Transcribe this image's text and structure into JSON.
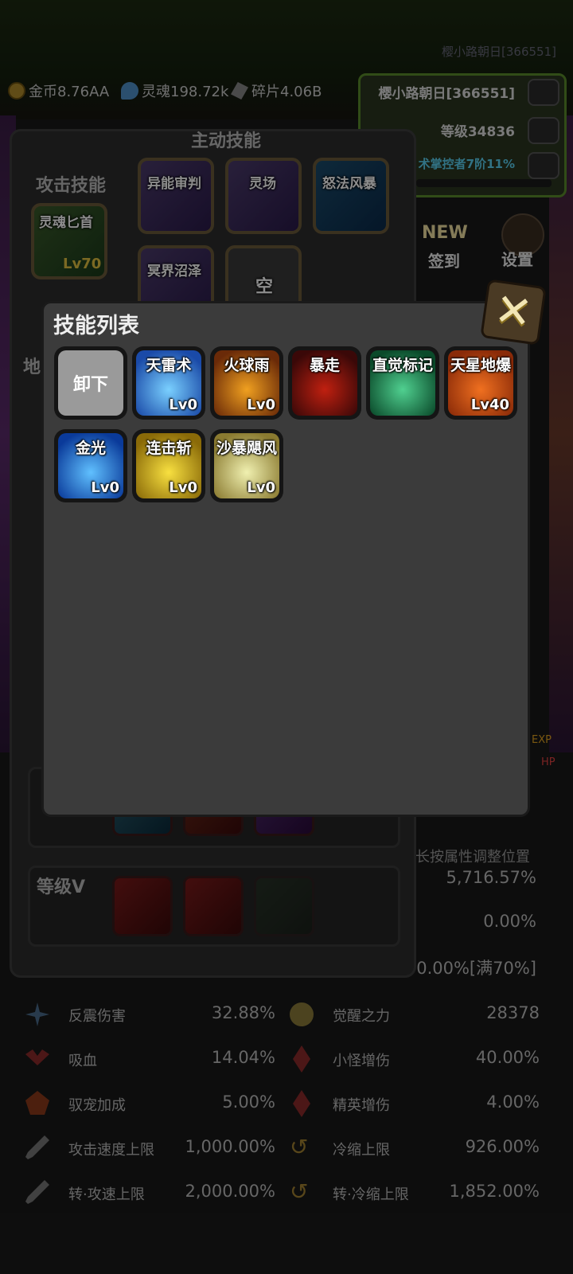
{
  "header": {
    "top_name": "樱小路朝日[366551]",
    "currencies": [
      {
        "icon": "coin-icon",
        "label": "金币8.76AA"
      },
      {
        "icon": "soul-icon",
        "label": "灵魂198.72k"
      },
      {
        "icon": "fragment-icon",
        "label": "碎片4.06B"
      }
    ]
  },
  "player": {
    "name": "樱小路朝日[366551]",
    "level": "等级34836",
    "mastery": "术掌控者7阶11%"
  },
  "side_buttons": {
    "new_badge": "NEW",
    "signin": "签到",
    "settings": "设置"
  },
  "skill_panel": {
    "active_title": "主动技能",
    "attack_title": "攻击技能",
    "attack_skill": {
      "name": "灵魂匕首",
      "level": "Lv70"
    },
    "active_skills": [
      "异能审判",
      "灵场",
      "怒法风暴",
      "冥界沼泽"
    ],
    "empty_slot": "空",
    "tab_partial": "地",
    "row_title_v": "等级V",
    "long_press_hint": "长按属性调整位置"
  },
  "side_stats": [
    "5,716.57%",
    "0.00%",
    "0.00%[满70%]"
  ],
  "stats": [
    {
      "label": "反震伤害",
      "value": "32.88%",
      "icon": "snowflake-icon"
    },
    {
      "label": "觉醒之力",
      "value": "28378",
      "icon": "flower-icon"
    },
    {
      "label": "吸血",
      "value": "14.04%",
      "icon": "bat-icon"
    },
    {
      "label": "小怪增伤",
      "value": "40.00%",
      "icon": "diamond-icon"
    },
    {
      "label": "驭宠加成",
      "value": "5.00%",
      "icon": "pet-icon"
    },
    {
      "label": "精英增伤",
      "value": "4.00%",
      "icon": "diamond-icon"
    },
    {
      "label": "攻击速度上限",
      "value": "1,000.00%",
      "icon": "sword-icon"
    },
    {
      "label": "冷缩上限",
      "value": "926.00%",
      "icon": "hook-icon"
    },
    {
      "label": "转·攻速上限",
      "value": "2,000.00%",
      "icon": "sword-icon"
    },
    {
      "label": "转·冷缩上限",
      "value": "1,852.00%",
      "icon": "hook-icon"
    }
  ],
  "bar_labels": {
    "exp": "EXP",
    "hp": "HP"
  },
  "modal": {
    "title": "技能列表",
    "unequip_label": "卸下",
    "skills": [
      {
        "name": "天雷术",
        "level": "Lv0",
        "color_a": "#1a4aa8",
        "color_b": "#7ad0ff"
      },
      {
        "name": "火球雨",
        "level": "Lv0",
        "color_a": "#6a2a08",
        "color_b": "#f0a020"
      },
      {
        "name": "暴走",
        "level": "",
        "color_a": "#3a0808",
        "color_b": "#c02010"
      },
      {
        "name": "直觉标记",
        "level": "",
        "color_a": "#0a4a2a",
        "color_b": "#50d090"
      },
      {
        "name": "天星地爆",
        "level": "Lv40",
        "color_a": "#8a2a08",
        "color_b": "#f07020"
      },
      {
        "name": "金光",
        "level": "Lv0",
        "color_a": "#0a3a9a",
        "color_b": "#60c0ff"
      },
      {
        "name": "连击斩",
        "level": "Lv0",
        "color_a": "#8a6a08",
        "color_b": "#f8e040"
      },
      {
        "name": "沙暴飓风",
        "level": "Lv0",
        "color_a": "#8a7a30",
        "color_b": "#f0f0b0"
      }
    ]
  }
}
